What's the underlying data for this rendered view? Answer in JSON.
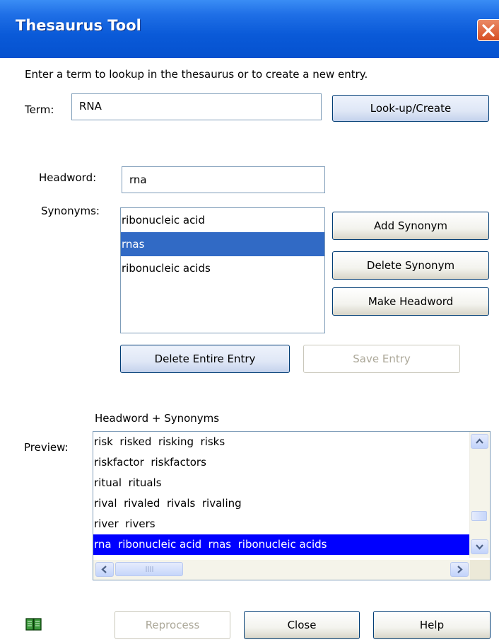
{
  "window": {
    "title": "Thesaurus Tool"
  },
  "intro_text": "Enter a term to lookup in the thesaurus or to create a new entry.",
  "term": {
    "label": "Term:",
    "value": "RNA"
  },
  "lookup_button": "Look-up/Create",
  "headword": {
    "label": "Headword:",
    "value": "rna"
  },
  "synonyms": {
    "label": "Synonyms:",
    "items": [
      "ribonucleic acid",
      "rnas",
      "ribonucleic acids"
    ],
    "selected_index": 1
  },
  "buttons": {
    "add_synonym": "Add Synonym",
    "delete_synonym": "Delete Synonym",
    "make_headword": "Make Headword",
    "delete_entry": "Delete Entire Entry",
    "save_entry": "Save Entry",
    "reprocess": "Reprocess",
    "close": "Close",
    "help": "Help"
  },
  "preview": {
    "label": "Preview:",
    "header": "Headword + Synonyms",
    "rows": [
      "risk  risked  risking  risks",
      "riskfactor  riskfactors",
      "ritual  rituals",
      "rival  rivaled  rivals  rivaling",
      "river  rivers",
      "rna  ribonucleic acid  rnas  ribonucleic acids"
    ],
    "selected_index": 5
  },
  "colors": {
    "titlebar": "#0a5ad8",
    "list_selection": "#316ac5",
    "preview_selection": "#0000ff",
    "close_button": "#d74e22"
  },
  "icons": {
    "close": "close-x-icon",
    "book": "book-icon",
    "scroll_up": "arrow-up-icon",
    "scroll_down": "arrow-down-icon",
    "scroll_left": "arrow-left-icon",
    "scroll_right": "arrow-right-icon"
  }
}
